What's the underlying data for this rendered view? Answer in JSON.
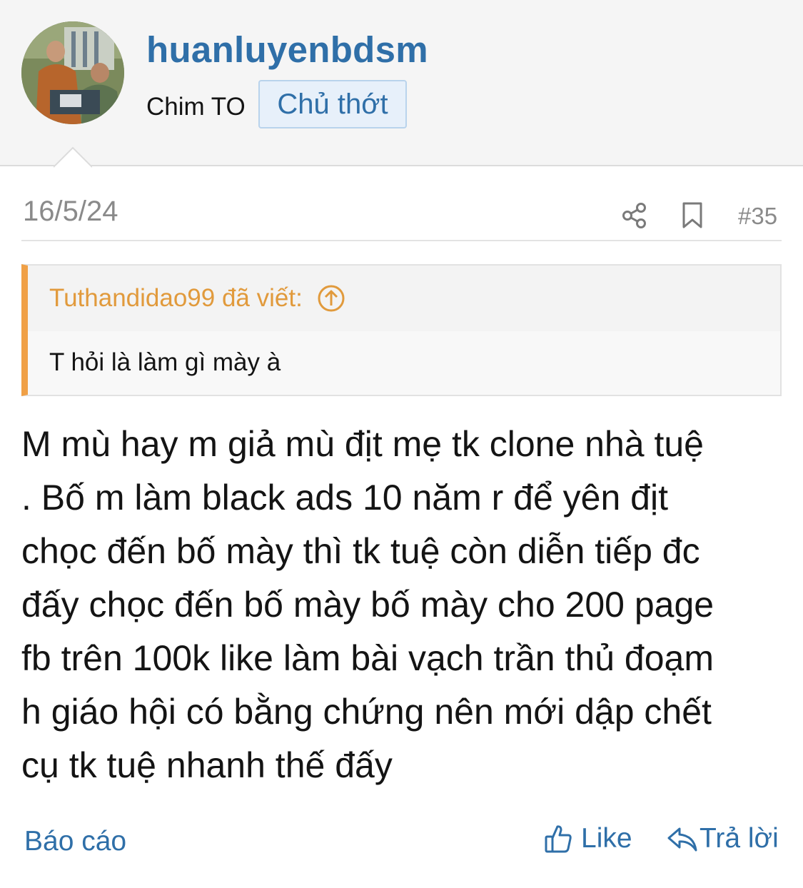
{
  "header": {
    "username": "huanluyenbdsm",
    "user_title": "Chim TO",
    "op_badge": "Chủ thớt",
    "avatar_icon": "user-avatar-photo"
  },
  "post": {
    "date": "16/5/24",
    "number": "#35",
    "share_icon": "share-icon",
    "bookmark_icon": "bookmark-icon"
  },
  "quote": {
    "author": "Tuthandidao99 đã viết:",
    "body": "T hỏi là làm gì mày à",
    "jump_icon": "arrow-up-circle-icon"
  },
  "message": {
    "lines": [
      "M mù hay m giả mù địt mẹ tk clone nhà tuệ",
      ". Bố m làm black ads 10 năm r để yên địt",
      "chọc đến bố mày thì tk tuệ còn diễn tiếp đc",
      "đấy chọc đến bố mày bố mày cho 200 page",
      "fb trên 100k like làm bài vạch trần thủ đoạm",
      "h giáo hội có bằng chứng nên mới dập chết",
      "cụ tk tuệ nhanh thế đấy"
    ]
  },
  "actions": {
    "report": "Báo cáo",
    "like": "Like",
    "reply": "Trả lời"
  },
  "colors": {
    "link": "#2f6fa8",
    "quote_accent": "#f0a046",
    "muted": "#8a8a8a"
  }
}
